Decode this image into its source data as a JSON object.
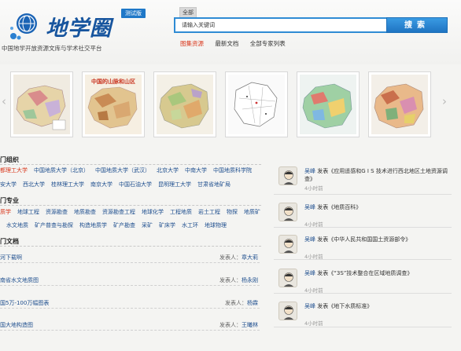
{
  "header": {
    "logo_title": "地学圈",
    "beta_badge": "测试版",
    "subtitle": "中国地学开放资源文库与学术社交平台",
    "search_tab": "全部",
    "search_placeholder": "请输入关键词",
    "search_button": "搜索",
    "sublinks": [
      "图集资源",
      "最新文档",
      "全部专家列表"
    ]
  },
  "carousel": {
    "prev_arrow": "‹",
    "next_arrow": "›",
    "thumbs": [
      {
        "name": "map-thumb-1",
        "caption": ""
      },
      {
        "name": "map-thumb-2",
        "caption": "中国的山脉和山区"
      },
      {
        "name": "map-thumb-3",
        "caption": ""
      },
      {
        "name": "map-thumb-4",
        "caption": ""
      },
      {
        "name": "map-thumb-5",
        "caption": ""
      },
      {
        "name": "map-thumb-6",
        "caption": ""
      }
    ]
  },
  "sections": {
    "orgs_title": "门组织",
    "majors_title": "门专业",
    "docs_title": "门文档",
    "orgs_row1": [
      "都理工大学",
      "中国地质大学（北京）",
      "中国地质大学（武汉）",
      "北京大学",
      "中南大学",
      "中国地质科学院"
    ],
    "orgs_row2": [
      "安大学",
      "西北大学",
      "桂林理工大学",
      "南京大学",
      "中国石油大学",
      "昆明理工大学",
      "甘肃省地矿局"
    ],
    "majors_row1": [
      "质学",
      "地球工程",
      "资源勘查",
      "地质勘查",
      "资源勘查工程",
      "地球化学",
      "工程地质",
      "岩土工程",
      "物探",
      "地质矿"
    ],
    "majors_row2": [
      "水文地质",
      "矿产普查与勘探",
      "构造地质学",
      "矿产勘查",
      "采矿",
      "矿床学",
      "水工环",
      "地球物理"
    ],
    "docs": [
      {
        "title": "河下载啊",
        "poster_label": "发表人：",
        "poster": "章大莉"
      },
      {
        "title": "南省水文地质图",
        "poster_label": "发表人：",
        "poster": "杨永刚"
      },
      {
        "title": "国5万-100万幅图表",
        "poster_label": "发表人：",
        "poster": "杨霖"
      },
      {
        "title": "国大地构造图",
        "poster_label": "发表人：",
        "poster": "王曦林"
      }
    ]
  },
  "feed": [
    {
      "user": "吴峰",
      "action": "发表《应用遥感和G I S 技术进行西北地区土地资源调查》",
      "time": "4小时前"
    },
    {
      "user": "吴峰",
      "action": "发表《地质百科》",
      "time": "4小时前"
    },
    {
      "user": "吴峰",
      "action": "发表《中华人民共和国国土资源部令》",
      "time": "4小时前"
    },
    {
      "user": "吴峰",
      "action": "发表《“3S”技术整合在区域地质调查》",
      "time": "4小时前"
    },
    {
      "user": "吴峰",
      "action": "发表《地下水质标准》",
      "time": "4小时前"
    }
  ],
  "colors": {
    "brand_blue": "#17559e",
    "accent_red": "#d9371c",
    "link_blue": "#1f4f8f",
    "search_blue": "#2f8bd4"
  }
}
